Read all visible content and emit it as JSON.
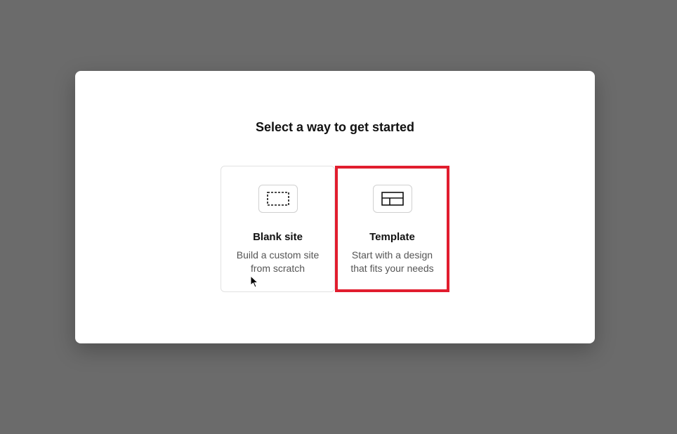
{
  "modal": {
    "title": "Select a way to get started",
    "options": [
      {
        "icon": "dashed-rectangle-icon",
        "title": "Blank site",
        "description": "Build a custom site from scratch",
        "highlighted": false
      },
      {
        "icon": "layout-template-icon",
        "title": "Template",
        "description": "Start with a design that fits your needs",
        "highlighted": true
      }
    ]
  },
  "highlight_color": "#e11d2e"
}
